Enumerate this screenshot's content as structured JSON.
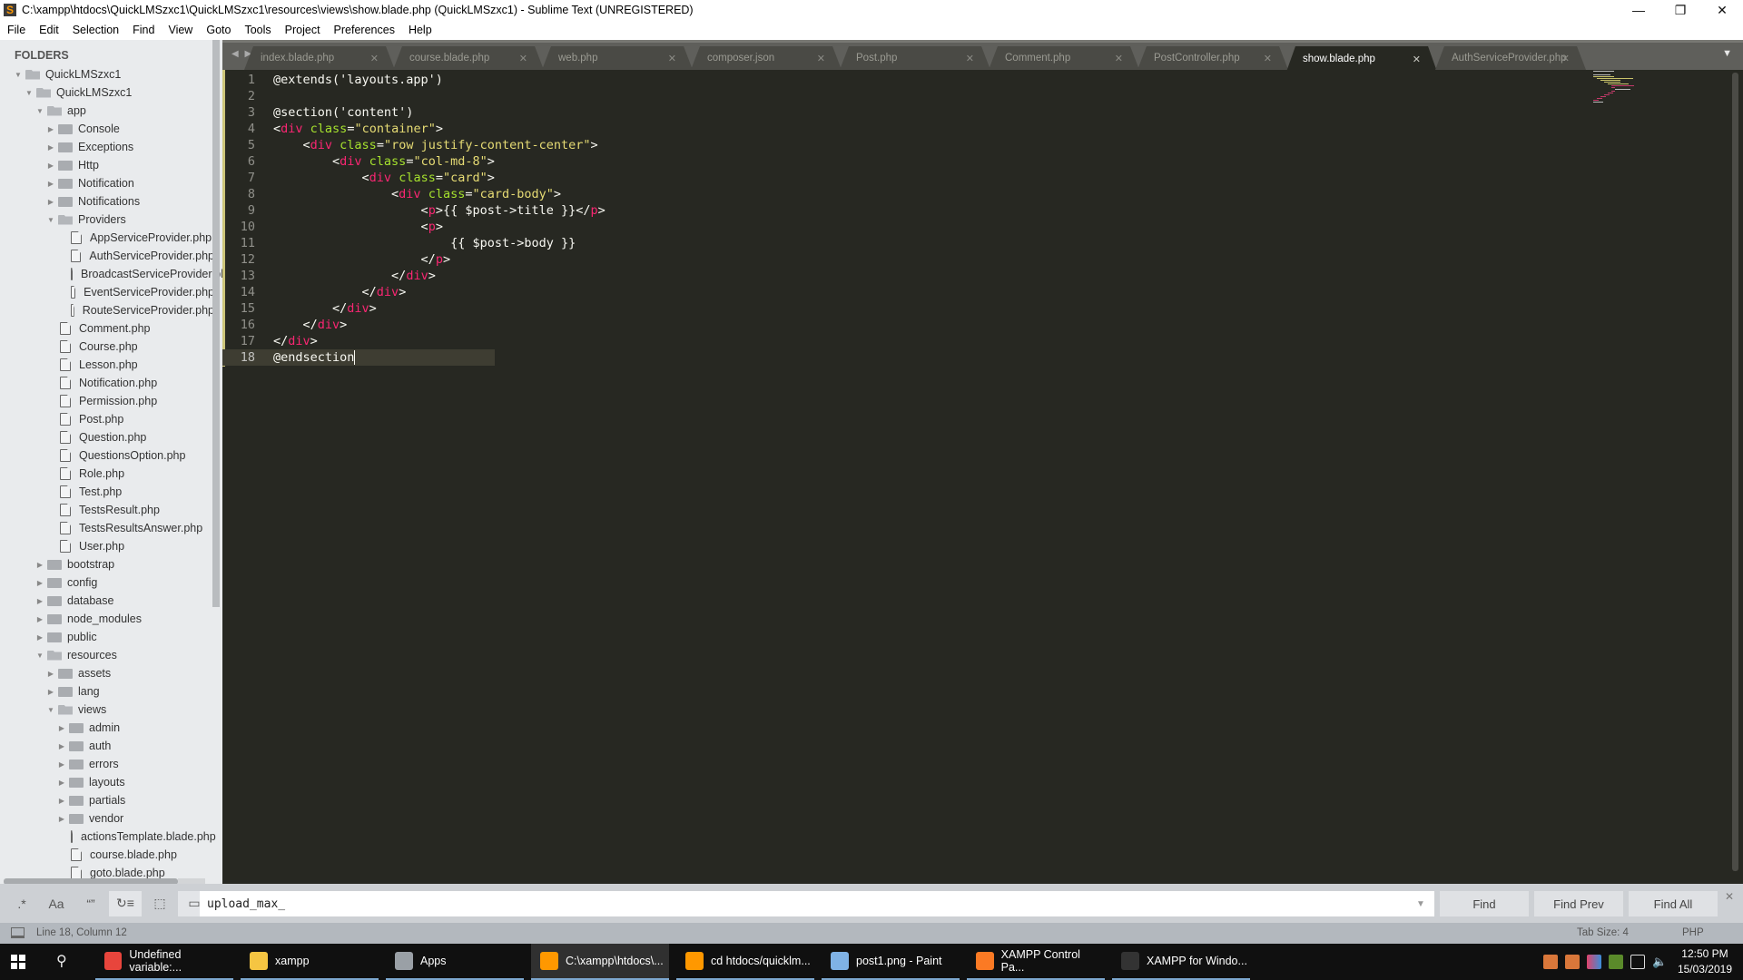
{
  "window": {
    "title": "C:\\xampp\\htdocs\\QuickLMSzxc1\\QuickLMSzxc1\\resources\\views\\show.blade.php (QuickLMSzxc1) - Sublime Text (UNREGISTERED)",
    "app_icon": "sublime-text-icon",
    "controls": {
      "minimize": "—",
      "maximize": "❐",
      "close": "✕"
    }
  },
  "menu": [
    "File",
    "Edit",
    "Selection",
    "Find",
    "View",
    "Goto",
    "Tools",
    "Project",
    "Preferences",
    "Help"
  ],
  "sidebar": {
    "header": "FOLDERS",
    "tree": [
      {
        "label": "QuickLMSzxc1",
        "type": "folder",
        "depth": 0,
        "expanded": true
      },
      {
        "label": "QuickLMSzxc1",
        "type": "folder",
        "depth": 1,
        "expanded": true
      },
      {
        "label": "app",
        "type": "folder",
        "depth": 2,
        "expanded": true
      },
      {
        "label": "Console",
        "type": "folder",
        "depth": 3,
        "expanded": false
      },
      {
        "label": "Exceptions",
        "type": "folder",
        "depth": 3,
        "expanded": false
      },
      {
        "label": "Http",
        "type": "folder",
        "depth": 3,
        "expanded": false
      },
      {
        "label": "Notification",
        "type": "folder",
        "depth": 3,
        "expanded": false
      },
      {
        "label": "Notifications",
        "type": "folder",
        "depth": 3,
        "expanded": false
      },
      {
        "label": "Providers",
        "type": "folder",
        "depth": 3,
        "expanded": true
      },
      {
        "label": "AppServiceProvider.php",
        "type": "file",
        "depth": 4
      },
      {
        "label": "AuthServiceProvider.php",
        "type": "file",
        "depth": 4
      },
      {
        "label": "BroadcastServiceProvider.php",
        "type": "file",
        "depth": 4
      },
      {
        "label": "EventServiceProvider.php",
        "type": "file",
        "depth": 4
      },
      {
        "label": "RouteServiceProvider.php",
        "type": "file",
        "depth": 4
      },
      {
        "label": "Comment.php",
        "type": "file",
        "depth": 3
      },
      {
        "label": "Course.php",
        "type": "file",
        "depth": 3
      },
      {
        "label": "Lesson.php",
        "type": "file",
        "depth": 3
      },
      {
        "label": "Notification.php",
        "type": "file",
        "depth": 3
      },
      {
        "label": "Permission.php",
        "type": "file",
        "depth": 3
      },
      {
        "label": "Post.php",
        "type": "file",
        "depth": 3
      },
      {
        "label": "Question.php",
        "type": "file",
        "depth": 3
      },
      {
        "label": "QuestionsOption.php",
        "type": "file",
        "depth": 3
      },
      {
        "label": "Role.php",
        "type": "file",
        "depth": 3
      },
      {
        "label": "Test.php",
        "type": "file",
        "depth": 3
      },
      {
        "label": "TestsResult.php",
        "type": "file",
        "depth": 3
      },
      {
        "label": "TestsResultsAnswer.php",
        "type": "file",
        "depth": 3
      },
      {
        "label": "User.php",
        "type": "file",
        "depth": 3
      },
      {
        "label": "bootstrap",
        "type": "folder",
        "depth": 2,
        "expanded": false
      },
      {
        "label": "config",
        "type": "folder",
        "depth": 2,
        "expanded": false
      },
      {
        "label": "database",
        "type": "folder",
        "depth": 2,
        "expanded": false
      },
      {
        "label": "node_modules",
        "type": "folder",
        "depth": 2,
        "expanded": false
      },
      {
        "label": "public",
        "type": "folder",
        "depth": 2,
        "expanded": false
      },
      {
        "label": "resources",
        "type": "folder",
        "depth": 2,
        "expanded": true
      },
      {
        "label": "assets",
        "type": "folder",
        "depth": 3,
        "expanded": false
      },
      {
        "label": "lang",
        "type": "folder",
        "depth": 3,
        "expanded": false
      },
      {
        "label": "views",
        "type": "folder",
        "depth": 3,
        "expanded": true
      },
      {
        "label": "admin",
        "type": "folder",
        "depth": 4,
        "expanded": false
      },
      {
        "label": "auth",
        "type": "folder",
        "depth": 4,
        "expanded": false
      },
      {
        "label": "errors",
        "type": "folder",
        "depth": 4,
        "expanded": false
      },
      {
        "label": "layouts",
        "type": "folder",
        "depth": 4,
        "expanded": false
      },
      {
        "label": "partials",
        "type": "folder",
        "depth": 4,
        "expanded": false
      },
      {
        "label": "vendor",
        "type": "folder",
        "depth": 4,
        "expanded": false
      },
      {
        "label": "actionsTemplate.blade.php",
        "type": "file",
        "depth": 4
      },
      {
        "label": "course.blade.php",
        "type": "file",
        "depth": 4
      },
      {
        "label": "goto.blade.php",
        "type": "file",
        "depth": 4
      }
    ]
  },
  "tabs": {
    "nav_arrows": "◀ ▶",
    "items": [
      {
        "label": "index.blade.php",
        "active": false
      },
      {
        "label": "course.blade.php",
        "active": false
      },
      {
        "label": "web.php",
        "active": false
      },
      {
        "label": "composer.json",
        "active": false
      },
      {
        "label": "Post.php",
        "active": false
      },
      {
        "label": "Comment.php",
        "active": false
      },
      {
        "label": "PostController.php",
        "active": false
      },
      {
        "label": "show.blade.php",
        "active": true
      },
      {
        "label": "AuthServiceProvider.php",
        "active": false
      }
    ],
    "close_glyph": "✕",
    "dropdown_glyph": "▼"
  },
  "editor": {
    "current_line": 18,
    "lines": [
      [
        {
          "t": "@extends('layouts.app')",
          "c": "punc"
        }
      ],
      [],
      [
        {
          "t": "@section('content')",
          "c": "punc"
        }
      ],
      [
        {
          "t": "<",
          "c": "punc"
        },
        {
          "t": "div",
          "c": "tag"
        },
        {
          "t": " class",
          "c": "attr"
        },
        {
          "t": "=",
          "c": "punc"
        },
        {
          "t": "\"container\"",
          "c": "str"
        },
        {
          "t": ">",
          "c": "punc"
        }
      ],
      [
        {
          "t": "    <",
          "c": "punc"
        },
        {
          "t": "div",
          "c": "tag"
        },
        {
          "t": " class",
          "c": "attr"
        },
        {
          "t": "=",
          "c": "punc"
        },
        {
          "t": "\"row justify-content-center\"",
          "c": "str"
        },
        {
          "t": ">",
          "c": "punc"
        }
      ],
      [
        {
          "t": "        <",
          "c": "punc"
        },
        {
          "t": "div",
          "c": "tag"
        },
        {
          "t": " class",
          "c": "attr"
        },
        {
          "t": "=",
          "c": "punc"
        },
        {
          "t": "\"col-md-8\"",
          "c": "str"
        },
        {
          "t": ">",
          "c": "punc"
        }
      ],
      [
        {
          "t": "            <",
          "c": "punc"
        },
        {
          "t": "div",
          "c": "tag"
        },
        {
          "t": " class",
          "c": "attr"
        },
        {
          "t": "=",
          "c": "punc"
        },
        {
          "t": "\"card\"",
          "c": "str"
        },
        {
          "t": ">",
          "c": "punc"
        }
      ],
      [
        {
          "t": "                <",
          "c": "punc"
        },
        {
          "t": "div",
          "c": "tag"
        },
        {
          "t": " class",
          "c": "attr"
        },
        {
          "t": "=",
          "c": "punc"
        },
        {
          "t": "\"card-body\"",
          "c": "str"
        },
        {
          "t": ">",
          "c": "punc"
        }
      ],
      [
        {
          "t": "                    <",
          "c": "punc"
        },
        {
          "t": "p",
          "c": "tag"
        },
        {
          "t": ">{{ $post->title }}</",
          "c": "punc"
        },
        {
          "t": "p",
          "c": "tag"
        },
        {
          "t": ">",
          "c": "punc"
        }
      ],
      [
        {
          "t": "                    <",
          "c": "punc"
        },
        {
          "t": "p",
          "c": "tag"
        },
        {
          "t": ">",
          "c": "punc"
        }
      ],
      [
        {
          "t": "                        {{ $post->body }}",
          "c": "punc"
        }
      ],
      [
        {
          "t": "                    </",
          "c": "punc"
        },
        {
          "t": "p",
          "c": "tag"
        },
        {
          "t": ">",
          "c": "punc"
        }
      ],
      [
        {
          "t": "                </",
          "c": "punc"
        },
        {
          "t": "div",
          "c": "tag"
        },
        {
          "t": ">",
          "c": "punc"
        }
      ],
      [
        {
          "t": "            </",
          "c": "punc"
        },
        {
          "t": "div",
          "c": "tag"
        },
        {
          "t": ">",
          "c": "punc"
        }
      ],
      [
        {
          "t": "        </",
          "c": "punc"
        },
        {
          "t": "div",
          "c": "tag"
        },
        {
          "t": ">",
          "c": "punc"
        }
      ],
      [
        {
          "t": "    </",
          "c": "punc"
        },
        {
          "t": "div",
          "c": "tag"
        },
        {
          "t": ">",
          "c": "punc"
        }
      ],
      [
        {
          "t": "</",
          "c": "punc"
        },
        {
          "t": "div",
          "c": "tag"
        },
        {
          "t": ">",
          "c": "punc"
        }
      ],
      [
        {
          "t": "@endsection",
          "c": "punc"
        }
      ]
    ]
  },
  "find": {
    "options": [
      {
        "name": "regex-toggle",
        "glyph": ".*",
        "on": false
      },
      {
        "name": "case-sensitive-toggle",
        "glyph": "Aa",
        "on": false
      },
      {
        "name": "whole-word-toggle",
        "glyph": "“”",
        "on": false
      },
      {
        "name": "wrap-toggle",
        "glyph": "↻≡",
        "on": true
      },
      {
        "name": "in-selection-toggle",
        "glyph": "⬚",
        "on": false
      },
      {
        "name": "highlight-matches-toggle",
        "glyph": "▭",
        "on": true
      }
    ],
    "value": "upload_max_",
    "dropdown_glyph": "▼",
    "buttons": {
      "find": "Find",
      "find_prev": "Find Prev",
      "find_all": "Find All"
    },
    "close_glyph": "✕"
  },
  "status": {
    "position": "Line 18, Column 12",
    "tab_size": "Tab Size: 4",
    "syntax": "PHP"
  },
  "taskbar": {
    "items": [
      {
        "label": "Undefined variable:...",
        "icon": "chrome-icon",
        "color": "#e8453c",
        "active": false
      },
      {
        "label": "xampp",
        "icon": "file-explorer-icon",
        "color": "#f5c542",
        "active": false
      },
      {
        "label": "Apps",
        "icon": "apps-icon",
        "color": "#9aa0a6",
        "active": false
      },
      {
        "label": "C:\\xampp\\htdocs\\...",
        "icon": "sublime-text-icon",
        "color": "#ff9800",
        "active": true
      },
      {
        "label": "cd htdocs/quicklm...",
        "icon": "sublime-text-icon",
        "color": "#ff9800",
        "active": false
      },
      {
        "label": "post1.png - Paint",
        "icon": "paint-icon",
        "color": "#7fb2e5",
        "active": false
      },
      {
        "label": "XAMPP Control Pa...",
        "icon": "xampp-icon",
        "color": "#fb7a24",
        "active": false
      },
      {
        "label": "XAMPP for Windo...",
        "icon": "terminal-icon",
        "color": "#333333",
        "active": false
      }
    ],
    "time": "12:50 PM",
    "date": "15/03/2019"
  }
}
